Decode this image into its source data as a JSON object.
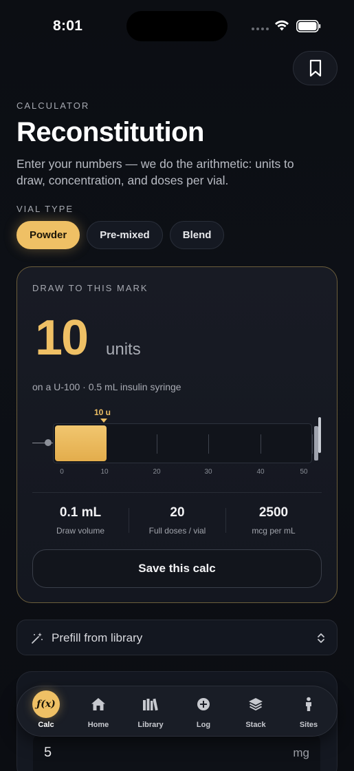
{
  "status": {
    "time": "8:01"
  },
  "header": {
    "eyebrow": "CALCULATOR",
    "title": "Reconstitution",
    "subtitle": "Enter your numbers — we do the arithmetic: units to draw, concentration, and doses per vial."
  },
  "vial_type": {
    "label": "VIAL TYPE",
    "options": [
      "Powder",
      "Pre-mixed",
      "Blend"
    ],
    "selected": "Powder"
  },
  "result": {
    "eyebrow": "DRAW TO THIS MARK",
    "units_value": "10",
    "units_label": "units",
    "syringe_note": "on a U-100 · 0.5 mL insulin syringe",
    "mark_label": "10 u",
    "fill_fraction": 0.2,
    "scale": [
      "0",
      "10",
      "20",
      "30",
      "40",
      "50"
    ],
    "stats": [
      {
        "value": "0.1 mL",
        "label": "Draw volume"
      },
      {
        "value": "20",
        "label": "Full doses / vial"
      },
      {
        "value": "2500",
        "label": "mcg per mL"
      }
    ],
    "save_label": "Save this calc"
  },
  "prefill": {
    "label": "Prefill from library"
  },
  "dose_field": {
    "value": "5",
    "unit": "mg"
  },
  "tabbar": {
    "items": [
      {
        "label": "Calc",
        "icon": "function-icon",
        "icon_text": "ƒ(x)"
      },
      {
        "label": "Home",
        "icon": "home-icon"
      },
      {
        "label": "Library",
        "icon": "library-icon"
      },
      {
        "label": "Log",
        "icon": "plus-circle-icon"
      },
      {
        "label": "Stack",
        "icon": "stack-icon"
      },
      {
        "label": "Sites",
        "icon": "person-icon"
      }
    ],
    "active": "Calc"
  },
  "colors": {
    "accent": "#efc065",
    "background": "#0c0e13"
  }
}
